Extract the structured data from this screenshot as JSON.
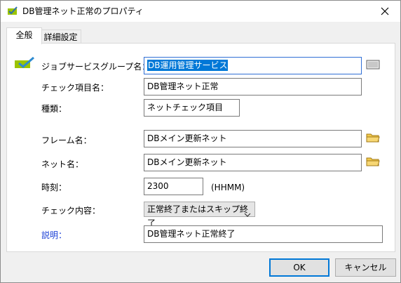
{
  "window": {
    "title": "DB管理ネット正常のプロパティ",
    "icon": "checklist-icon"
  },
  "tabs": [
    {
      "label": "全般",
      "active": true
    },
    {
      "label": "詳細設定",
      "active": false
    }
  ],
  "form": {
    "job_service_group": {
      "label": "ジョブサービスグループ名：",
      "value": "DB運用管理サービス"
    },
    "check_item_name": {
      "label": "チェック項目名：",
      "value": "DB管理ネット正常"
    },
    "type": {
      "label": "種類：",
      "value": "ネットチェック項目"
    },
    "frame_name": {
      "label": "フレーム名：",
      "value": "DBメイン更新ネット"
    },
    "net_name": {
      "label": "ネット名：",
      "value": "DBメイン更新ネット"
    },
    "time": {
      "label": "時刻：",
      "value": "2300",
      "unit": "(HHMM)"
    },
    "check_content": {
      "label": "チェック内容：",
      "value": "正常終了またはスキップ終了"
    },
    "description": {
      "label": "説明：",
      "value": "DB管理ネット正常終了"
    }
  },
  "buttons": {
    "ok": "OK",
    "cancel": "キャンセル"
  },
  "colors": {
    "accent": "#0078d7",
    "link": "#1a3fd6",
    "check": "#2e8bd0",
    "check_box": "#9bc400"
  }
}
